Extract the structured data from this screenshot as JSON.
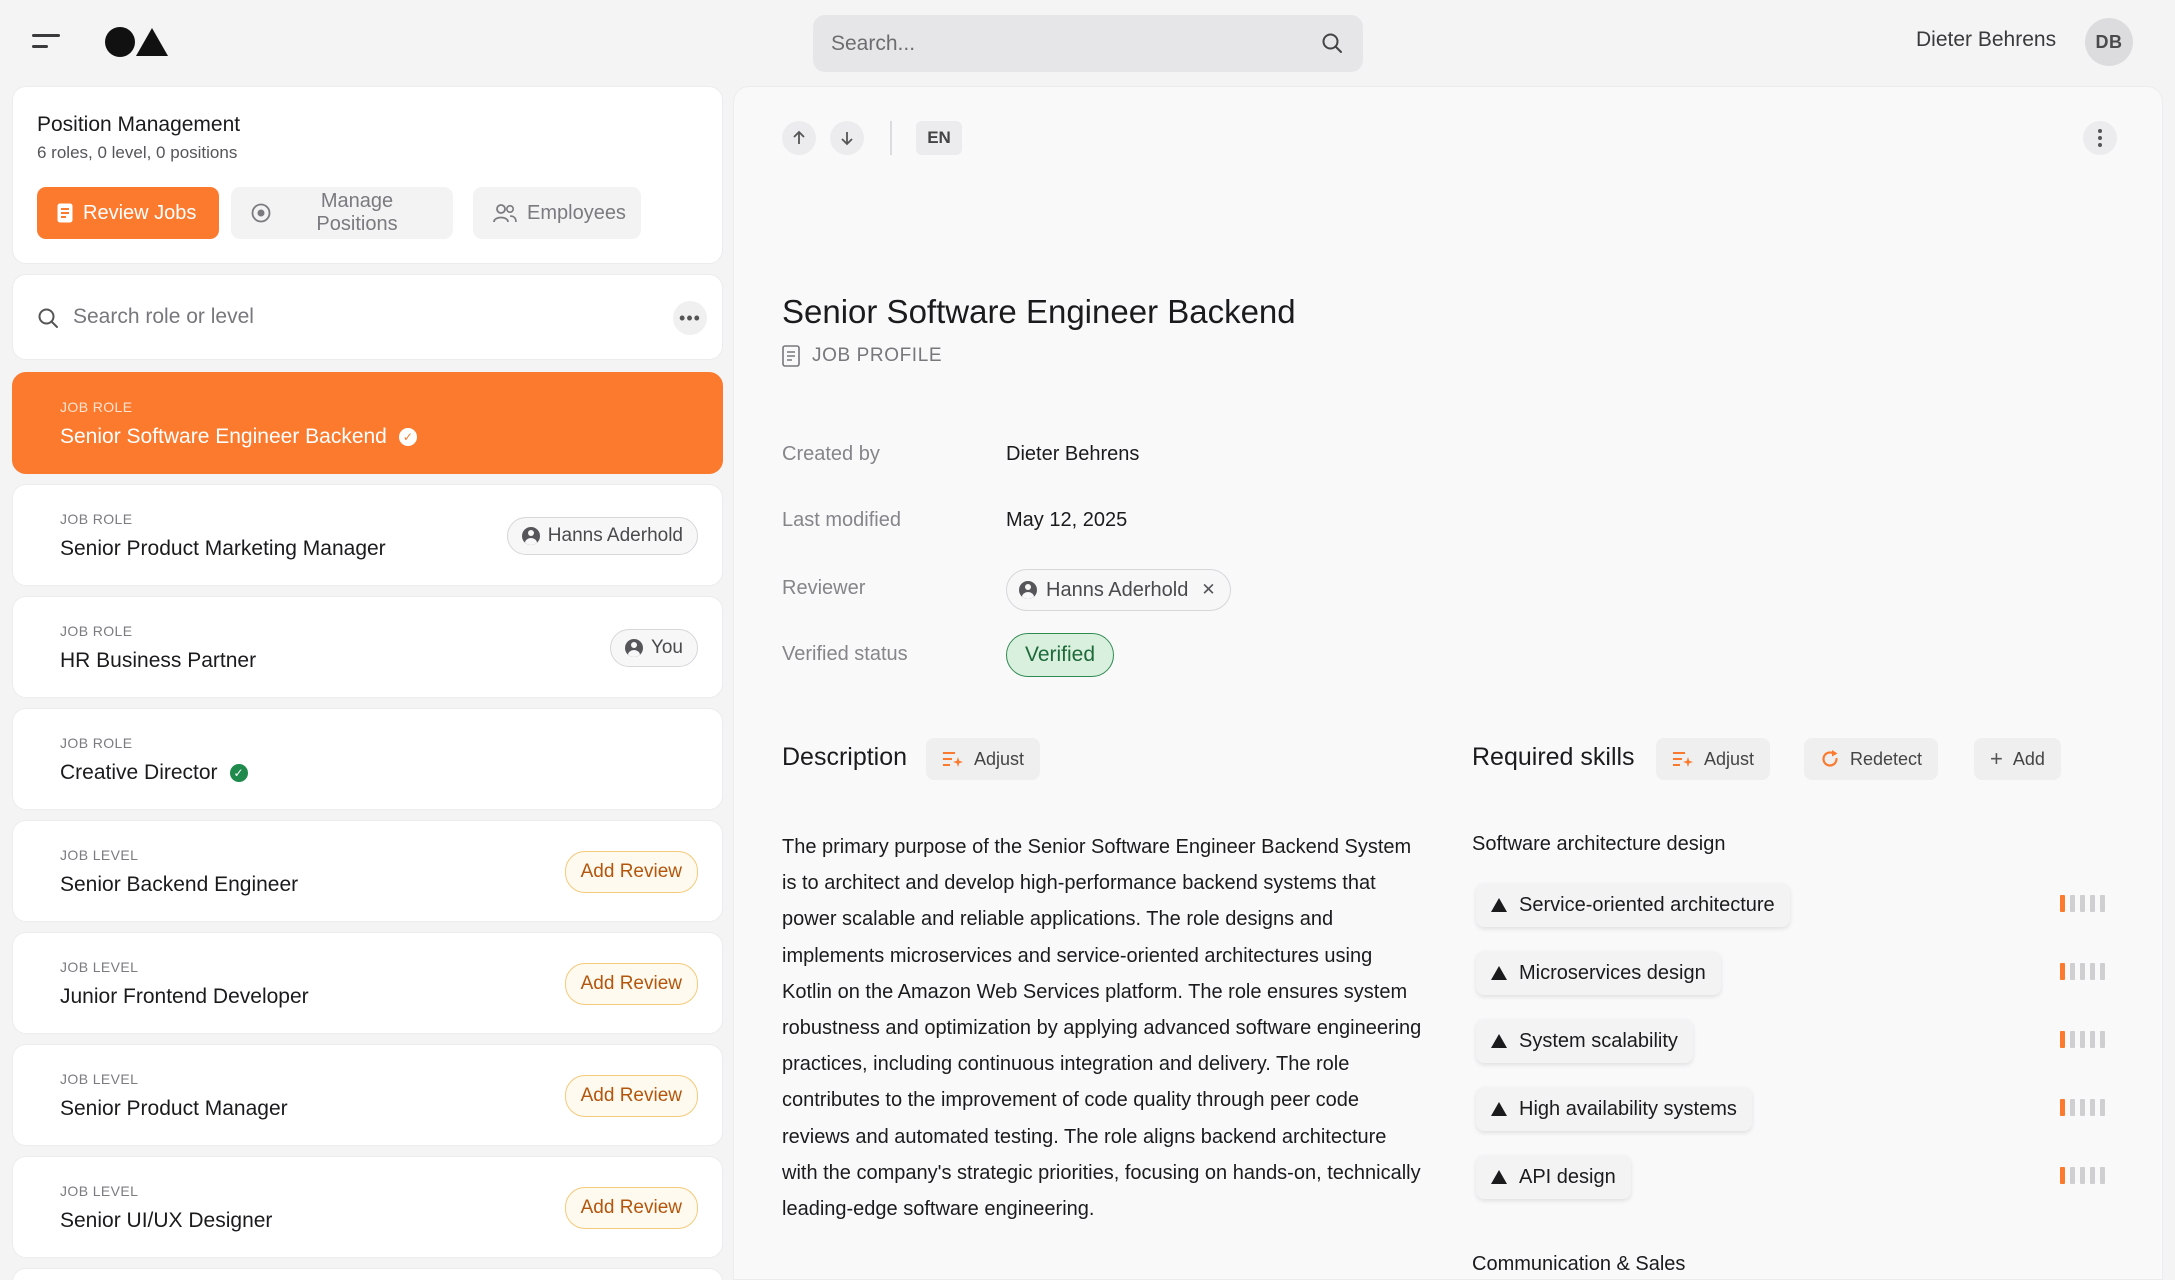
{
  "topbar": {
    "search_placeholder": "Search...",
    "user_name": "Dieter Behrens",
    "user_initials": "DB"
  },
  "position_management": {
    "title": "Position Management",
    "subtitle": "6 roles, 0 level, 0 positions",
    "buttons": {
      "review_jobs": "Review Jobs",
      "manage_positions": "Manage Positions",
      "employees": "Employees"
    }
  },
  "role_search": {
    "placeholder": "Search role or level"
  },
  "roles": [
    {
      "kind": "JOB ROLE",
      "name": "Senior Software Engineer Backend",
      "active": true,
      "verified": true
    },
    {
      "kind": "JOB ROLE",
      "name": "Senior Product Marketing Manager",
      "assignee": "Hanns Aderhold"
    },
    {
      "kind": "JOB ROLE",
      "name": "HR Business Partner",
      "assignee": "You"
    },
    {
      "kind": "JOB ROLE",
      "name": "Creative Director",
      "verified": true
    },
    {
      "kind": "JOB LEVEL",
      "name": "Senior Backend Engineer",
      "action": "Add Review"
    },
    {
      "kind": "JOB LEVEL",
      "name": "Junior Frontend Developer",
      "action": "Add Review"
    },
    {
      "kind": "JOB LEVEL",
      "name": "Senior Product Manager",
      "action": "Add Review"
    },
    {
      "kind": "JOB LEVEL",
      "name": "Senior UI/UX Designer",
      "action": "Add Review"
    }
  ],
  "detail": {
    "language": "EN",
    "title": "Senior Software Engineer Backend",
    "profile_label": "JOB PROFILE",
    "meta": {
      "created_by_label": "Created by",
      "created_by": "Dieter Behrens",
      "last_modified_label": "Last modified",
      "last_modified": "May 12, 2025",
      "reviewer_label": "Reviewer",
      "reviewer": "Hanns Aderhold",
      "verified_label": "Verified status",
      "verified": "Verified"
    },
    "description": {
      "title": "Description",
      "adjust": "Adjust",
      "text": "The primary purpose of the Senior Software Engineer Backend System is to architect and develop high-performance backend systems that power scalable and reliable applications. The role designs and implements microservices and service-oriented architectures using Kotlin on the Amazon Web Services platform. The role ensures system robustness and optimization by applying advanced software engineering practices, including continuous integration and delivery. The role contributes to the improvement of code quality through peer code reviews and automated testing. The role aligns backend architecture with the company's strategic priorities, focusing on hands-on, technically leading-edge software engineering."
    },
    "skills": {
      "title": "Required skills",
      "adjust": "Adjust",
      "redetect": "Redetect",
      "add": "Add",
      "groups": [
        {
          "name": "Software architecture design",
          "items": [
            {
              "name": "Service-oriented architecture",
              "level": 1,
              "max": 5
            },
            {
              "name": "Microservices design",
              "level": 1,
              "max": 5
            },
            {
              "name": "System scalability",
              "level": 1,
              "max": 5
            },
            {
              "name": "High availability systems",
              "level": 1,
              "max": 5
            },
            {
              "name": "API design",
              "level": 1,
              "max": 5
            }
          ]
        },
        {
          "name": "Communication & Sales",
          "items": []
        }
      ]
    }
  },
  "colors": {
    "accent": "#fb7a2e",
    "verified_green": "#1f8a4c",
    "review_border": "#f6c978"
  }
}
